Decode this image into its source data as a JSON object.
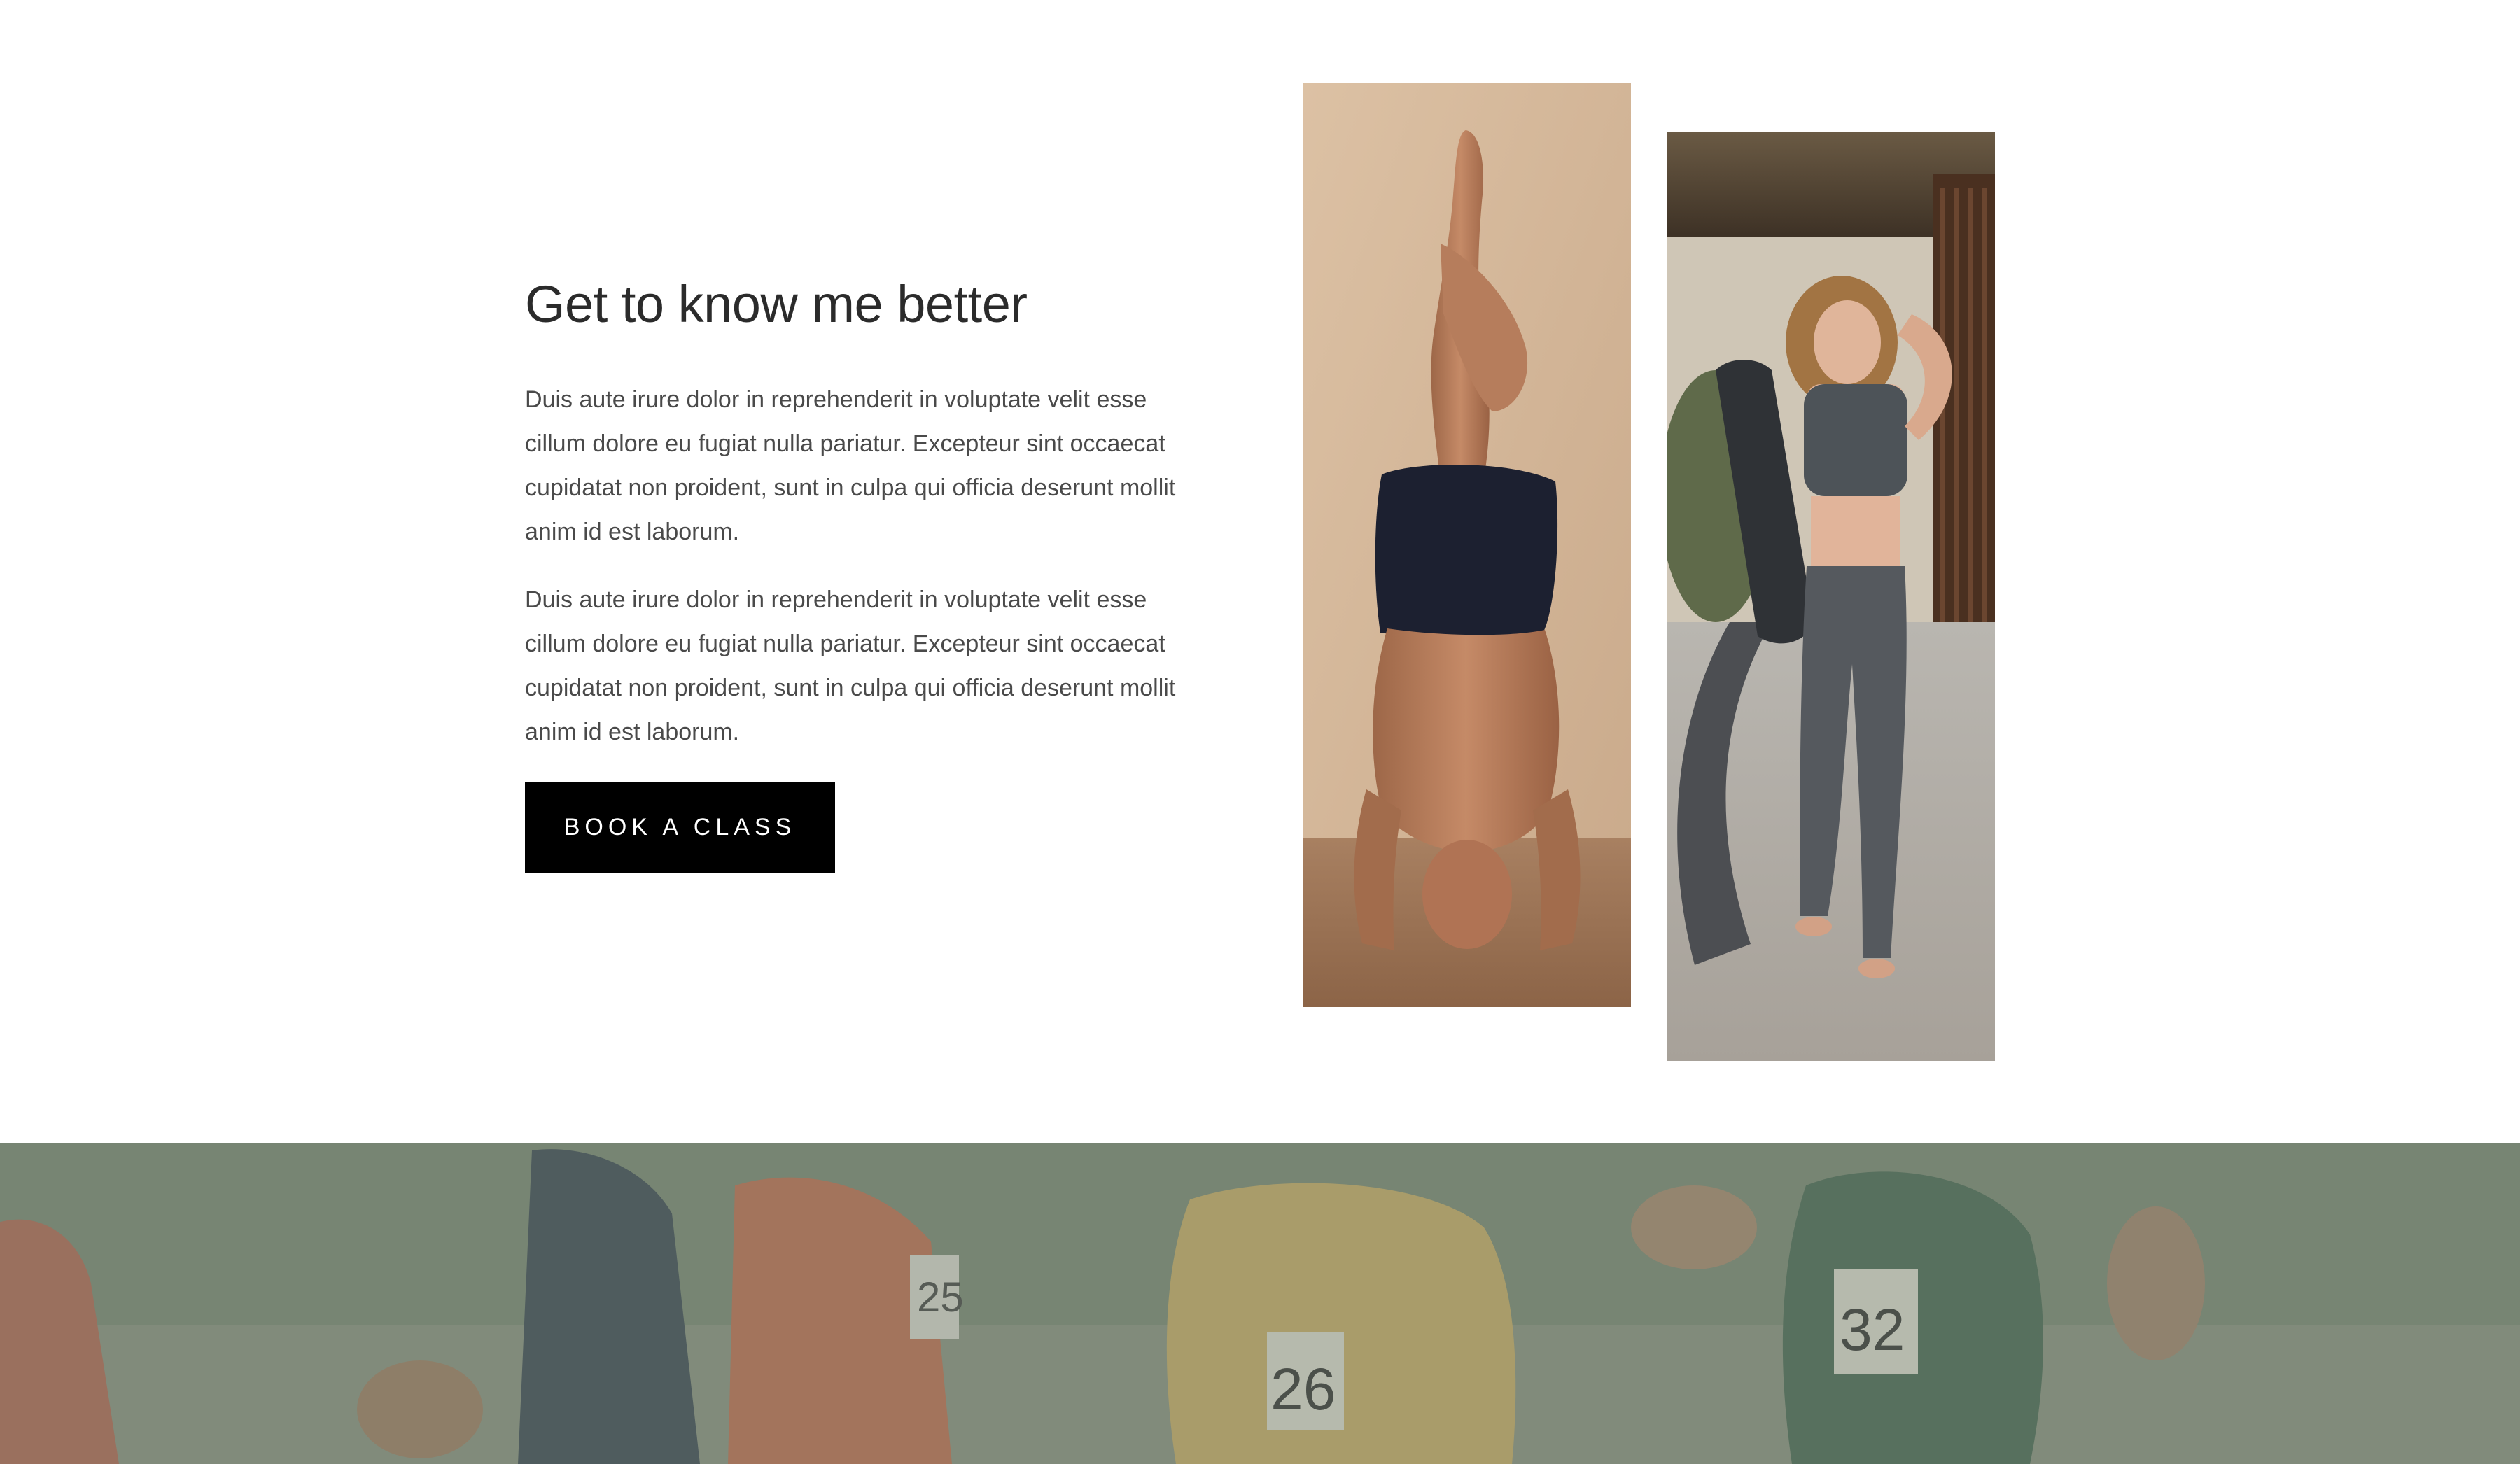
{
  "about": {
    "title": "Get to know me better",
    "paragraphs": [
      "Duis aute irure dolor in reprehenderit in voluptate velit esse cillum dolore eu fugiat nulla pariatur. Excepteur sint occaecat cupidatat non proident, sunt in culpa qui officia deserunt mollit anim id est laborum.",
      "Duis aute irure dolor in reprehenderit in voluptate velit esse cillum dolore eu fugiat nulla pariatur. Excepteur sint occaecat cupidatat non proident, sunt in culpa qui officia deserunt mollit anim id est laborum."
    ],
    "cta_label": "BOOK A CLASS"
  },
  "photos": {
    "headstand": "headstand-photo",
    "mat": "woman-with-yoga-mat-photo"
  },
  "banner": {
    "image": "runners-photo",
    "bibs": [
      "26",
      "32",
      "25"
    ]
  },
  "colors": {
    "button_bg": "#000000",
    "button_text": "#ffffff",
    "heading": "#2b2b2b",
    "body_text": "#4a4a4a",
    "banner_overlay": "#7d8a78"
  }
}
